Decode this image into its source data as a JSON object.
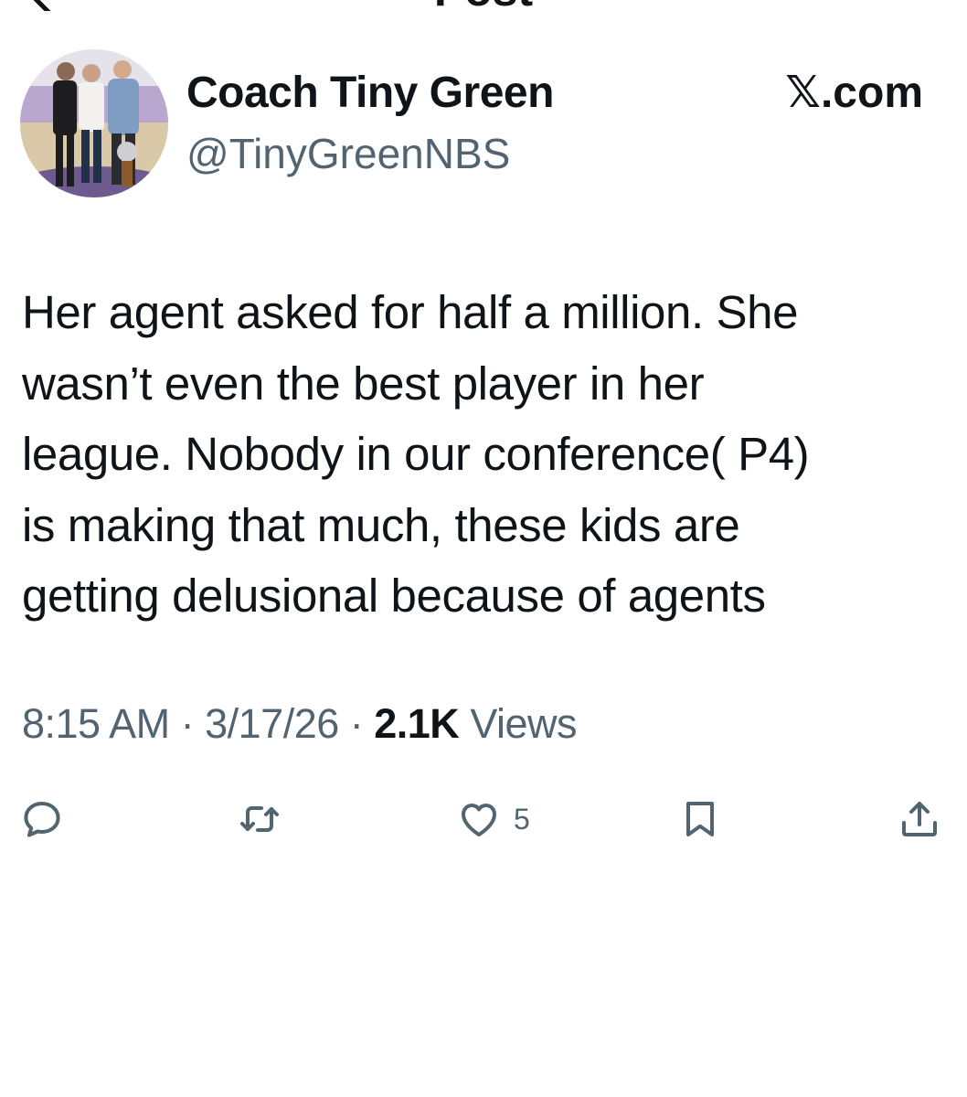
{
  "header": {
    "title": "Post"
  },
  "author": {
    "name": "Coach Tiny Green",
    "handle": "@TinyGreenNBS",
    "avatar": "avatar-photo"
  },
  "site_label": "𝕏.com",
  "tweet": {
    "text": "Her agent asked for half a million. She\nwasn’t even the best player in her\nleague. Nobody in our conference( P4)\nis making that much, these kids are\ngetting delusional because of agents"
  },
  "meta": {
    "time": "8:15 AM",
    "separator1": " · ",
    "date": "3/17/26",
    "separator2": " · ",
    "views_count": "2.1K",
    "views_label": " Views"
  },
  "actions": {
    "reply": {
      "icon": "reply-icon"
    },
    "retweet": {
      "icon": "retweet-icon"
    },
    "like": {
      "icon": "heart-icon",
      "count": "5"
    },
    "bookmark": {
      "icon": "bookmark-icon"
    },
    "share": {
      "icon": "share-icon"
    }
  },
  "colors": {
    "text_primary": "#0f1419",
    "text_secondary": "#536471",
    "background": "#ffffff"
  }
}
